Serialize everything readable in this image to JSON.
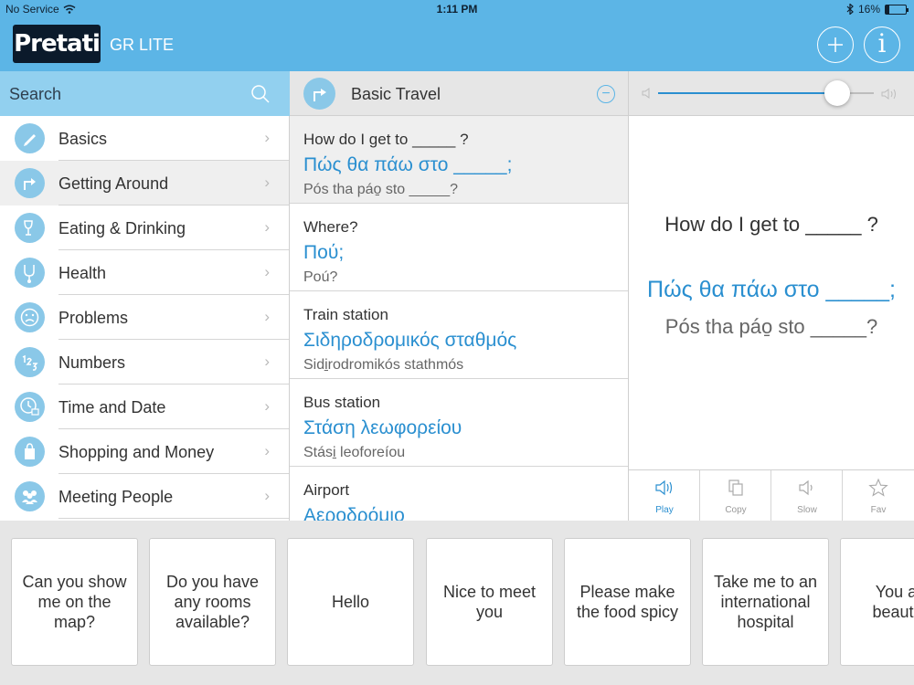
{
  "status": {
    "carrier": "No Service",
    "time": "1:11 PM",
    "battery_percent": "16%",
    "battery_level": 0.16
  },
  "header": {
    "logo_text": "Pretati",
    "edition": "GR LITE",
    "add_icon": "plus-circle-icon",
    "info_label": "i"
  },
  "search": {
    "placeholder": "Search"
  },
  "sidebar": {
    "items": [
      {
        "label": "Basics",
        "icon": "pen-icon"
      },
      {
        "label": "Getting Around",
        "icon": "turn-arrow-icon"
      },
      {
        "label": "Eating & Drinking",
        "icon": "glass-icon"
      },
      {
        "label": "Health",
        "icon": "stethoscope-icon"
      },
      {
        "label": "Problems",
        "icon": "sad-face-icon"
      },
      {
        "label": "Numbers",
        "icon": "numbers-icon"
      },
      {
        "label": "Time and Date",
        "icon": "clock-icon"
      },
      {
        "label": "Shopping and Money",
        "icon": "shopping-bag-icon"
      },
      {
        "label": "Meeting People",
        "icon": "people-icon"
      }
    ],
    "chevron": "›"
  },
  "category": {
    "title": "Basic Travel",
    "remove_label": "−"
  },
  "phrases": [
    {
      "en": "How do I get to _____ ?",
      "gr": "Πώς θα πάω στο _____;",
      "tr": "Pós tha páo̱ sto _____?"
    },
    {
      "en": "Where?",
      "gr": "Πού;",
      "tr": "Poú?"
    },
    {
      "en": "Train station",
      "gr": "Σιδηροδρομικός σταθμός",
      "tr": "Sidi̱rodromikós stathmós"
    },
    {
      "en": "Bus station",
      "gr": "Στάση λεωφορείου",
      "tr": "Stási̱ leoforeíou"
    },
    {
      "en": "Airport",
      "gr": "Αεροδρόμιο",
      "tr": ""
    }
  ],
  "volume": {
    "level": 0.83
  },
  "detail": {
    "en": "How do I get to _____ ?",
    "gr": "Πώς θα πάω στο _____;",
    "tr": "Pós tha páo̱ sto _____?"
  },
  "actions": [
    {
      "label": "Play",
      "icon": "speaker-icon"
    },
    {
      "label": "Copy",
      "icon": "copy-icon"
    },
    {
      "label": "Slow",
      "icon": "speaker-slow-icon"
    },
    {
      "label": "Fav",
      "icon": "star-icon"
    }
  ],
  "quick_phrases": [
    "Can you show me on the map?",
    "Do you have any rooms available?",
    "Hello",
    "Nice to meet you",
    "Please make the food spicy",
    "Take me to an international hospital",
    "You are beautiful"
  ],
  "colors": {
    "accent": "#5cb5e6",
    "greek_text": "#2a8fd0",
    "icon_bg": "#8ac8e8",
    "logo_bg": "#0b1a2b"
  }
}
